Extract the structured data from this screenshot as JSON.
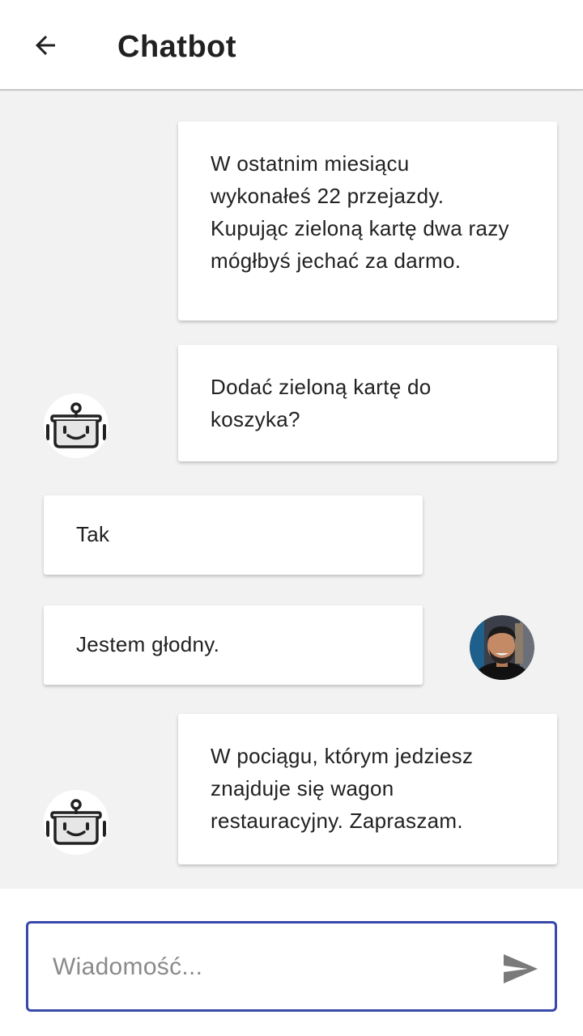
{
  "app_bar": {
    "title": "Chatbot",
    "back_icon": "arrow-left-icon"
  },
  "messages": [
    {
      "sender": "bot",
      "text": "W ostatnim miesiącu\nwykonałeś 22 przejazdy.\nKupując zieloną kartę dwa razy\nmógłbyś jechać za darmo."
    },
    {
      "sender": "bot",
      "text": "Dodać zieloną kartę do\nkoszyka?"
    },
    {
      "sender": "user",
      "text": "Tak"
    },
    {
      "sender": "user",
      "text": "Jestem głodny."
    },
    {
      "sender": "bot",
      "text": "W pociągu, którym jedziesz\nznajduje się wagon\nrestauracyjny. Zapraszam."
    }
  ],
  "composer": {
    "placeholder": "Wiadomość...",
    "value": "",
    "send_icon": "send-icon"
  },
  "colors": {
    "accent": "#3949ab",
    "chat_background": "#f2f2f2",
    "bubble": "#ffffff"
  }
}
